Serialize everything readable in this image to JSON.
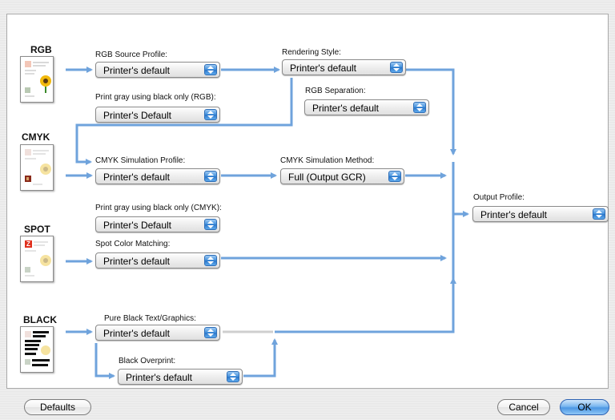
{
  "colorspaces": {
    "rgb": "RGB",
    "cmyk": "CMYK",
    "spot": "SPOT",
    "black": "BLACK"
  },
  "labels": {
    "rgb_source_profile": "RGB Source Profile:",
    "rendering_style": "Rendering Style:",
    "rgb_separation": "RGB Separation:",
    "print_gray_rgb": "Print gray using black only (RGB):",
    "cmyk_simulation_profile": "CMYK Simulation Profile:",
    "cmyk_simulation_method": "CMYK Simulation Method:",
    "output_profile": "Output Profile:",
    "print_gray_cmyk": "Print gray using black only (CMYK):",
    "spot_color_matching": "Spot Color Matching:",
    "pure_black": "Pure Black Text/Graphics:",
    "black_overprint": "Black Overprint:"
  },
  "popups": {
    "rgb_source_profile": "Printer's default",
    "rendering_style": "Printer's default",
    "rgb_separation": "Printer's default",
    "print_gray_rgb": "Printer's Default",
    "cmyk_simulation_profile": "Printer's default",
    "cmyk_simulation_method": "Full (Output GCR)",
    "output_profile": "Printer's default",
    "print_gray_cmyk": "Printer's Default",
    "spot_color_matching": "Printer's default",
    "pure_black": "Printer's default",
    "black_overprint": "Printer's default"
  },
  "buttons": {
    "defaults": "Defaults",
    "cancel": "Cancel",
    "ok": "OK"
  },
  "colors": {
    "flow_arrow": "#6fa3dc",
    "flow_inactive": "#cfcfcf",
    "accent": "#3f8fdc"
  }
}
